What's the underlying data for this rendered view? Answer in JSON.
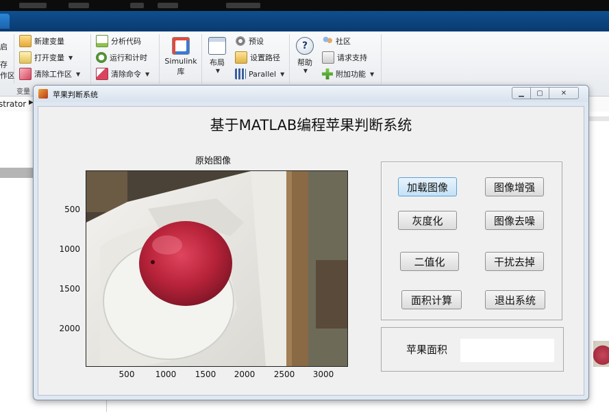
{
  "ribbon": {
    "left_cut": {
      "line1": "启",
      "line2": "存",
      "line3": "作区"
    },
    "variable_group": {
      "new_variable": "新建变量",
      "open_variable": "打开变量",
      "clear_workspace": "清除工作区",
      "label": "变量"
    },
    "code_group": {
      "analyze_code": "分析代码",
      "run_and_time": "运行和计时",
      "clear_commands": "清除命令"
    },
    "simulink": {
      "line1": "Simulink",
      "line2": "库"
    },
    "layout": "布局",
    "env_group": {
      "preferences": "预设",
      "set_path": "设置路径",
      "parallel": "Parallel"
    },
    "help": "帮助",
    "resources_group": {
      "community": "社区",
      "request_support": "请求支持",
      "addons": "附加功能"
    }
  },
  "pathbar": {
    "text": "strator"
  },
  "figure": {
    "window_title": "苹果判断系统",
    "main_title": "基于MATLAB编程苹果判断系统",
    "axes": {
      "title": "原始图像",
      "yticks": [
        "500",
        "1000",
        "1500",
        "2000"
      ],
      "xticks": [
        "500",
        "1000",
        "1500",
        "2000",
        "2500",
        "3000"
      ]
    },
    "buttons": {
      "load_image": "加载图像",
      "enhance_image": "图像增强",
      "grayscale": "灰度化",
      "denoise_image": "图像去噪",
      "binarize": "二值化",
      "remove_interference": "干扰去掉",
      "compute_area": "面积计算",
      "exit_system": "退出系统"
    },
    "area": {
      "label": "苹果面积",
      "value": ""
    }
  },
  "colors": {
    "tabstrip": "#0e4f8f",
    "accent_button": "#c3e1f6",
    "apple": "#b8233a"
  }
}
